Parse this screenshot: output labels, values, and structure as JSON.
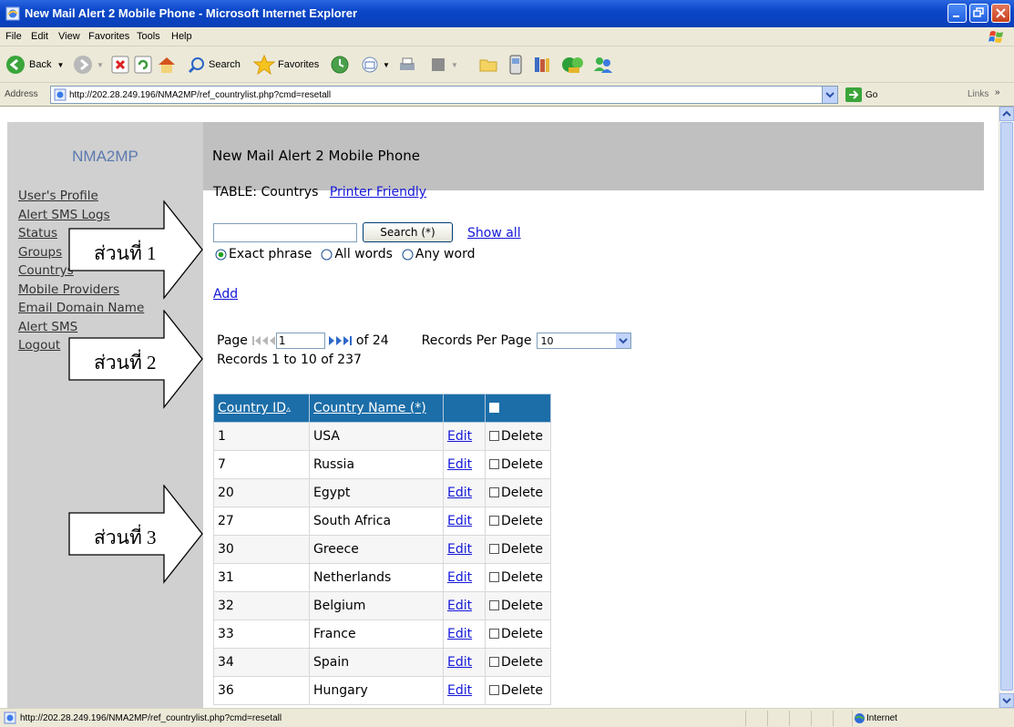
{
  "window": {
    "title": "New Mail Alert 2 Mobile Phone - Microsoft Internet Explorer"
  },
  "menu": [
    "File",
    "Edit",
    "View",
    "Favorites",
    "Tools",
    "Help"
  ],
  "toolbar": {
    "back": "Back",
    "search": "Search",
    "favorites": "Favorites"
  },
  "address": {
    "label": "Address",
    "url": "http://202.28.249.196/NMA2MP/ref_countrylist.php?cmd=resetall",
    "go": "Go",
    "links": "Links"
  },
  "app": {
    "brand": "NMA2MP",
    "header_title": "New Mail Alert 2 Mobile Phone"
  },
  "sidebar": {
    "items": [
      "User's Profile",
      "Alert SMS Logs",
      "Status",
      "Groups",
      "Countrys",
      "Mobile Providers",
      "Email Domain Name",
      "Alert SMS",
      "Logout"
    ]
  },
  "main": {
    "table_label": "TABLE: Countrys",
    "printer_friendly": "Printer Friendly",
    "search": {
      "value": "",
      "button": "Search (*)",
      "show_all": "Show all",
      "options": [
        "Exact phrase",
        "All words",
        "Any word"
      ],
      "selected": "Exact phrase"
    },
    "add": "Add",
    "pager": {
      "page_label": "Page",
      "page": "1",
      "of_label": "of 24",
      "per_page_label": "Records Per Page",
      "per_page": "10",
      "records_text": "Records 1 to 10 of 237"
    },
    "columns": {
      "id": "Country ID",
      "name": "Country Name (*)",
      "edit": "",
      "select": ""
    },
    "edit_label": "Edit",
    "delete_label": "Delete",
    "rows": [
      {
        "id": "1",
        "name": "USA"
      },
      {
        "id": "7",
        "name": "Russia"
      },
      {
        "id": "20",
        "name": "Egypt"
      },
      {
        "id": "27",
        "name": "South Africa"
      },
      {
        "id": "30",
        "name": "Greece"
      },
      {
        "id": "31",
        "name": "Netherlands"
      },
      {
        "id": "32",
        "name": "Belgium"
      },
      {
        "id": "33",
        "name": "France"
      },
      {
        "id": "34",
        "name": "Spain"
      },
      {
        "id": "36",
        "name": "Hungary"
      }
    ]
  },
  "callouts": [
    "ส่วนที่ 1",
    "ส่วนที่ 2",
    "ส่วนที่ 3"
  ],
  "status": {
    "url": "http://202.28.249.196/NMA2MP/ref_countrylist.php?cmd=resetall",
    "zone": "Internet"
  },
  "colors": {
    "titlebar": "#0a46c8",
    "table_header": "#1c6ea8",
    "link": "#1418d8",
    "sidebar": "#d0d0d0"
  }
}
